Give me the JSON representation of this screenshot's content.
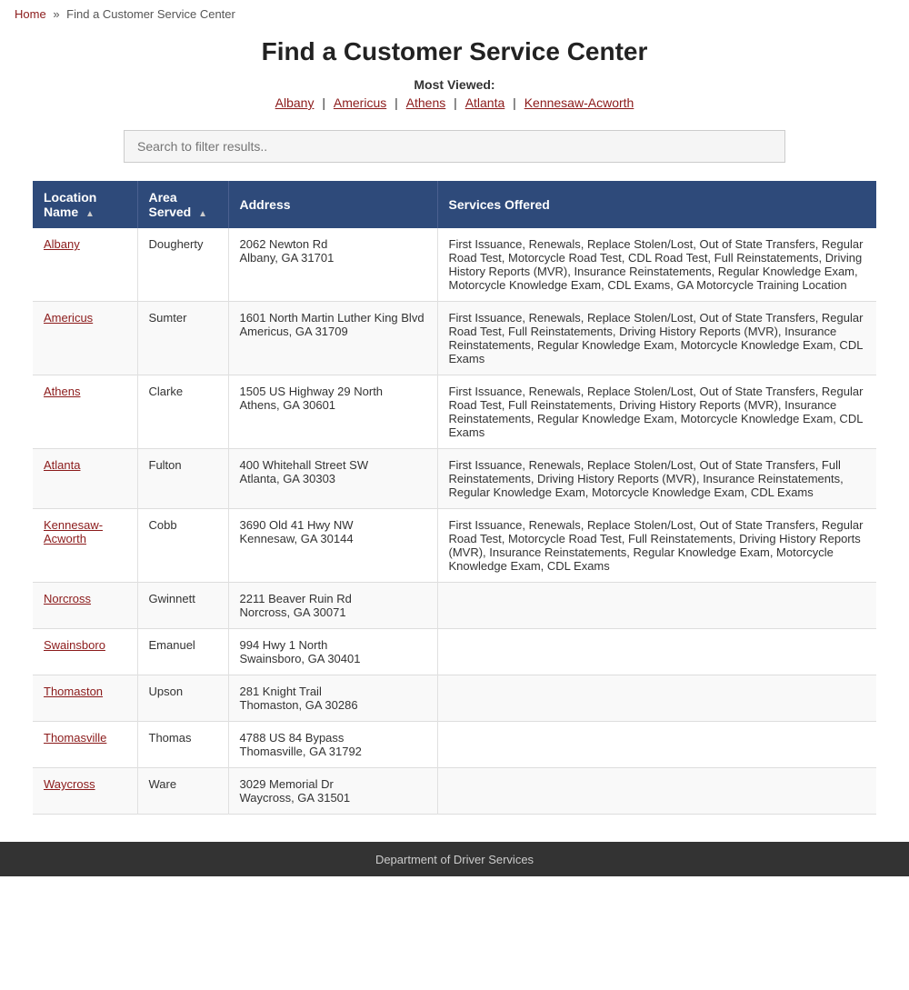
{
  "breadcrumb": {
    "home": "Home",
    "separator": "»",
    "current": "Find a Customer Service Center"
  },
  "page": {
    "title": "Find a Customer Service Center",
    "most_viewed_label": "Most Viewed:",
    "most_viewed_links": [
      {
        "label": "Albany",
        "href": "#"
      },
      {
        "label": "Americus",
        "href": "#"
      },
      {
        "label": "Athens",
        "href": "#"
      },
      {
        "label": "Atlanta",
        "href": "#"
      },
      {
        "label": "Kennesaw-Acworth",
        "href": "#"
      }
    ],
    "search_placeholder": "Search to filter results.."
  },
  "table": {
    "headers": [
      {
        "label": "Location Name",
        "sortable": true,
        "col": "col-location"
      },
      {
        "label": "Area Served",
        "sortable": true,
        "col": "col-area"
      },
      {
        "label": "Address",
        "sortable": false,
        "col": "col-address"
      },
      {
        "label": "Services Offered",
        "sortable": false,
        "col": "col-services"
      }
    ],
    "rows": [
      {
        "location": "Albany",
        "area": "Dougherty",
        "address_line1": "2062 Newton Rd",
        "address_line2": "Albany, GA 31701",
        "services": "First Issuance, Renewals, Replace Stolen/Lost, Out of State Transfers, Regular Road Test, Motorcycle Road Test, CDL Road Test, Full Reinstatements, Driving History Reports (MVR), Insurance Reinstatements, Regular Knowledge Exam, Motorcycle Knowledge Exam, CDL Exams, GA Motorcycle Training Location"
      },
      {
        "location": "Americus",
        "area": "Sumter",
        "address_line1": "1601 North Martin Luther King Blvd",
        "address_line2": "Americus, GA 31709",
        "services": "First Issuance, Renewals, Replace Stolen/Lost, Out of State Transfers, Regular Road Test, Full Reinstatements, Driving History Reports (MVR), Insurance Reinstatements, Regular Knowledge Exam, Motorcycle Knowledge Exam, CDL Exams"
      },
      {
        "location": "Athens",
        "area": "Clarke",
        "address_line1": "1505 US Highway 29 North",
        "address_line2": "Athens, GA 30601",
        "services": "First Issuance, Renewals, Replace Stolen/Lost, Out of State Transfers, Regular Road Test, Full Reinstatements, Driving History Reports (MVR), Insurance Reinstatements, Regular Knowledge Exam, Motorcycle Knowledge Exam, CDL Exams"
      },
      {
        "location": "Atlanta",
        "area": "Fulton",
        "address_line1": "400 Whitehall Street SW",
        "address_line2": "Atlanta, GA 30303",
        "services": "First Issuance, Renewals, Replace Stolen/Lost, Out of State Transfers, Full Reinstatements, Driving History Reports (MVR), Insurance Reinstatements, Regular Knowledge Exam, Motorcycle Knowledge Exam, CDL Exams"
      },
      {
        "location": "Kennesaw-Acworth",
        "area": "Cobb",
        "address_line1": "3690 Old 41 Hwy NW",
        "address_line2": "Kennesaw, GA 30144",
        "services": "First Issuance, Renewals, Replace Stolen/Lost, Out of State Transfers, Regular Road Test, Motorcycle Road Test, Full Reinstatements, Driving History Reports (MVR), Insurance Reinstatements, Regular Knowledge Exam, Motorcycle Knowledge Exam, CDL Exams"
      },
      {
        "location": "Norcross",
        "area": "Gwinnett",
        "address_line1": "2211 Beaver Ruin Rd",
        "address_line2": "Norcross, GA 30071",
        "services": ""
      },
      {
        "location": "Swainsboro",
        "area": "Emanuel",
        "address_line1": "994 Hwy 1 North",
        "address_line2": "Swainsboro, GA 30401",
        "services": ""
      },
      {
        "location": "Thomaston",
        "area": "Upson",
        "address_line1": "281 Knight Trail",
        "address_line2": "Thomaston, GA 30286",
        "services": ""
      },
      {
        "location": "Thomasville",
        "area": "Thomas",
        "address_line1": "4788 US 84 Bypass",
        "address_line2": "Thomasville, GA 31792",
        "services": ""
      },
      {
        "location": "Waycross",
        "area": "Ware",
        "address_line1": "3029 Memorial Dr",
        "address_line2": "Waycross, GA 31501",
        "services": ""
      }
    ]
  },
  "footer": {
    "link_label": "Department of Driver Services"
  }
}
